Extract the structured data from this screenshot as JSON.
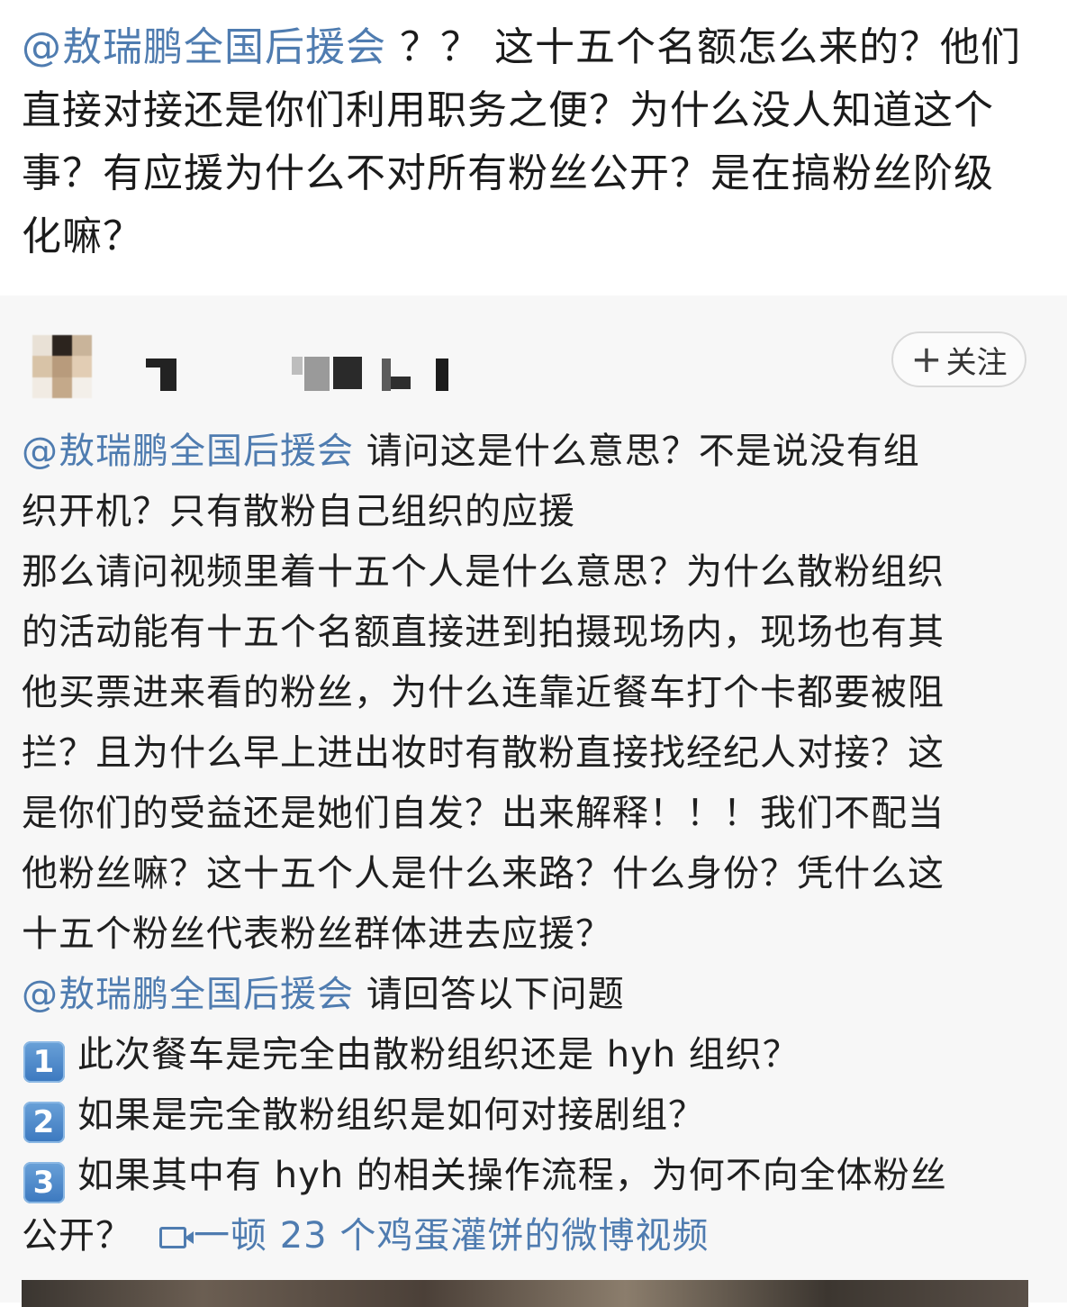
{
  "top_comment": {
    "mention": "@敖瑞鹏全国后援会",
    "text": " ？？ 这十五个名额怎么来的？他们直接对接还是你们利用职务之便？为什么没人知道这个事？有应援为什么不对所有粉丝公开？是在搞粉丝阶级化嘛？"
  },
  "post": {
    "username": "[blurred]",
    "follow_button": {
      "plus": "+",
      "label": "关注"
    },
    "paragraph1": {
      "mention": "@敖瑞鹏全国后援会",
      "line1_rest": " 请问这是什么意思？不是说没有组",
      "line2": "织开机？只有散粉自己组织的应援"
    },
    "paragraph2_lines": [
      "那么请问视频里着十五个人是什么意思？为什么散粉组织",
      "的活动能有十五个名额直接进到拍摄现场内，现场也有其",
      "他买票进来看的粉丝，为什么连靠近餐车打个卡都要被阻",
      "拦？且为什么早上进出妆时有散粉直接找经纪人对接？这",
      "是你们的受益还是她们自发？出来解释！！！我们不配当",
      "他粉丝嘛？这十五个人是什么来路？什么身份？凭什么这",
      "十五个粉丝代表粉丝群体进去应援？"
    ],
    "paragraph3": {
      "mention": "@敖瑞鹏全国后援会",
      "text": " 请回答以下问题"
    },
    "questions": [
      {
        "num": "1",
        "text": "此次餐车是完全由散粉组织还是 hyh 组织？"
      },
      {
        "num": "2",
        "text": "如果是完全散粉组织是如何对接剧组？"
      },
      {
        "num": "3",
        "text": "如果其中有 hyh 的相关操作流程，为何不向全体粉丝"
      }
    ],
    "last_line_start": "公开？",
    "video_link": "一顿 23 个鸡蛋灌饼的微博视频"
  },
  "colors": {
    "mention": "#4f7cb0",
    "badge": "#3b78bf",
    "card_bg": "#f7f7f7"
  },
  "icons": {
    "video_icon": "video-camera-icon",
    "number_badges": "keycap-number-emoji"
  }
}
